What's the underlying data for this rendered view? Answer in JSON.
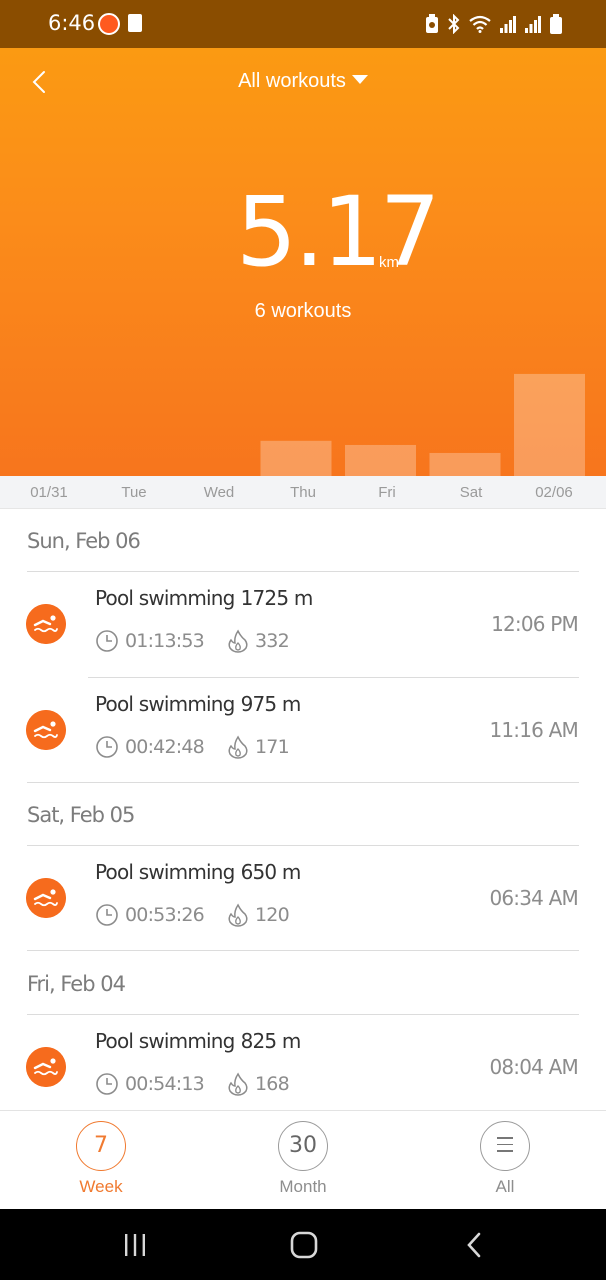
{
  "status_bar": {
    "time": "6:46",
    "icons": [
      "app-notification-icon",
      "sd-card-icon",
      "battery-saver-icon",
      "bluetooth-icon",
      "wifi-icon",
      "signal-icon",
      "signal-icon",
      "battery-icon"
    ]
  },
  "header": {
    "filter_label": "All workouts",
    "total_distance": "5.17",
    "distance_unit": "km",
    "workout_count": "6 workouts"
  },
  "chart_data": {
    "type": "bar",
    "categories": [
      "01/31",
      "Tue",
      "Wed",
      "Thu",
      "Fri",
      "Sat",
      "02/06"
    ],
    "values": [
      0,
      0,
      0,
      1.1,
      0.97,
      0.72,
      3.19
    ],
    "ylabel": "",
    "xlabel": ""
  },
  "days": [
    "01/31",
    "Tue",
    "Wed",
    "Thu",
    "Fri",
    "Sat",
    "02/06"
  ],
  "sections": [
    {
      "date": "Sun, Feb 06",
      "workouts": [
        {
          "type": "Pool swimming",
          "distance": "1725 m",
          "duration": "01:13:53",
          "calories": "332",
          "time": "12:06 PM"
        },
        {
          "type": "Pool swimming",
          "distance": "975 m",
          "duration": "00:42:48",
          "calories": "171",
          "time": "11:16 AM"
        }
      ]
    },
    {
      "date": "Sat, Feb 05",
      "workouts": [
        {
          "type": "Pool swimming",
          "distance": "650 m",
          "duration": "00:53:26",
          "calories": "120",
          "time": "06:34 AM"
        }
      ]
    },
    {
      "date": "Fri, Feb 04",
      "workouts": [
        {
          "type": "Pool swimming",
          "distance": "825 m",
          "duration": "00:54:13",
          "calories": "168",
          "time": "08:04 AM"
        }
      ]
    }
  ],
  "tabs": [
    {
      "badge": "7",
      "label": "Week",
      "active": true
    },
    {
      "badge": "30",
      "label": "Month",
      "active": false
    },
    {
      "badge": "",
      "label": "All",
      "active": false,
      "icon": "menu-icon"
    }
  ],
  "colors": {
    "accent": "#f07a30",
    "header_top": "#fb9a12",
    "header_bottom": "#f7751d",
    "icon_bg": "#f66b1d",
    "status_bar": "#8a4d00"
  }
}
